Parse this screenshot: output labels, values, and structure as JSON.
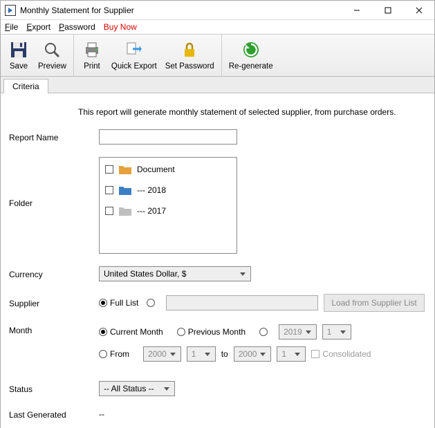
{
  "window": {
    "title": "Monthly Statement for Supplier"
  },
  "menu": {
    "file": "File",
    "export": "Export",
    "password": "Password",
    "buy": "Buy Now"
  },
  "toolbar": {
    "save": "Save",
    "preview": "Preview",
    "print": "Print",
    "quick_export": "Quick Export",
    "set_password": "Set Password",
    "regenerate": "Re-generate"
  },
  "tabs": {
    "criteria": "Criteria"
  },
  "form": {
    "description": "This report will generate monthly statement of selected supplier, from purchase orders.",
    "labels": {
      "report_name": "Report Name",
      "folder": "Folder",
      "currency": "Currency",
      "supplier": "Supplier",
      "month": "Month",
      "status": "Status",
      "last_generated": "Last Generated"
    },
    "report_name_value": "",
    "folders": [
      {
        "name": "Document",
        "color": "#e6a23c"
      },
      {
        "name": "--- 2018",
        "color": "#3d7fc4"
      },
      {
        "name": "--- 2017",
        "color": "#bfbfbf"
      }
    ],
    "currency_value": "United States Dollar, $",
    "supplier": {
      "full_list": "Full List",
      "load_button": "Load from Supplier List"
    },
    "month": {
      "current": "Current Month",
      "previous": "Previous Month",
      "year1": "2019",
      "mon1": "1",
      "from_label": "From",
      "from_year": "2000",
      "from_mon": "1",
      "to_label": "to",
      "to_year": "2000",
      "to_mon": "1",
      "consolidated": "Consolidated"
    },
    "status_value": "-- All Status --",
    "last_generated_value": "--"
  }
}
